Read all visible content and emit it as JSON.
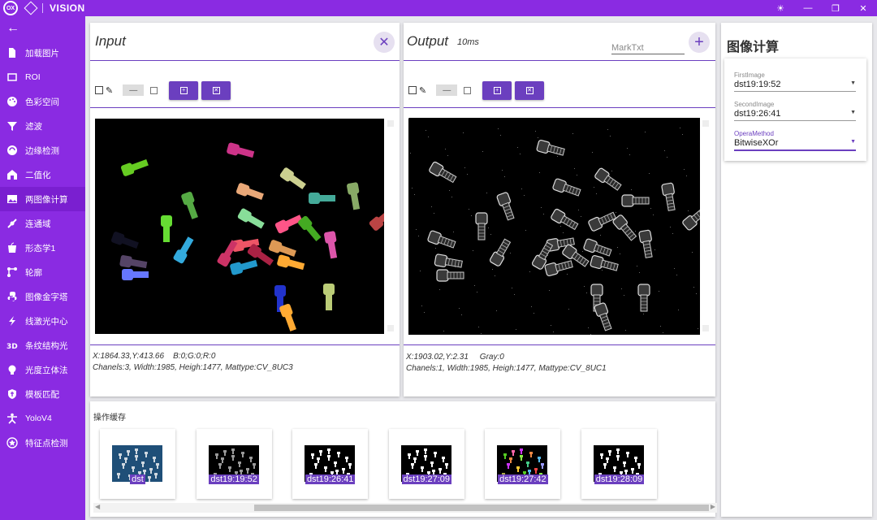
{
  "app": {
    "title": "VISION",
    "logo_text": "OX"
  },
  "sidebar": {
    "items": [
      {
        "label": "加载图片",
        "icon": "file-icon"
      },
      {
        "label": "ROI",
        "icon": "rectangle-icon"
      },
      {
        "label": "色彩空间",
        "icon": "palette-icon"
      },
      {
        "label": "滤波",
        "icon": "filter-icon"
      },
      {
        "label": "边缘检测",
        "icon": "edge-detect-icon"
      },
      {
        "label": "二值化",
        "icon": "home-icon"
      },
      {
        "label": "两图像计算",
        "icon": "image-icon"
      },
      {
        "label": "连通域",
        "icon": "connect-icon"
      },
      {
        "label": "形态学1",
        "icon": "apple-icon"
      },
      {
        "label": "轮廓",
        "icon": "contour-icon"
      },
      {
        "label": "图像金字塔",
        "icon": "python-icon"
      },
      {
        "label": "线激光中心",
        "icon": "flash-icon"
      },
      {
        "label": "条纹结构光",
        "icon": "3d-icon"
      },
      {
        "label": "光度立体法",
        "icon": "bulb-icon"
      },
      {
        "label": "模板匹配",
        "icon": "shield-icon"
      },
      {
        "label": "YoloV4",
        "icon": "person-icon"
      },
      {
        "label": "特征点检测",
        "icon": "star-icon"
      }
    ],
    "active_index": 6
  },
  "input_panel": {
    "title": "Input",
    "info_line1": "X:1864.33,Y:413.66    B:0;G:0;R:0",
    "info_line2": "Chanels:3, Width:1985, Heigh:1477, Mattype:CV_8UC3"
  },
  "output_panel": {
    "title": "Output",
    "time": "10ms",
    "mark_placeholder": "MarkTxt",
    "info_line1": "X:1903.02,Y:2.31     Gray:0",
    "info_line2": "Chanels:1, Width:1985, Heigh:1477, Mattype:CV_8UC1"
  },
  "right_panel": {
    "title": "图像计算",
    "fields": [
      {
        "label": "FirstImage",
        "value": "dst19:19:52"
      },
      {
        "label": "SecondImage",
        "value": "dst19:26:41"
      },
      {
        "label": "OperaMethod",
        "value": "BitwiseXOr"
      }
    ]
  },
  "cache": {
    "title": "操作缓存",
    "items": [
      {
        "label": "dst",
        "kind": "color-photo"
      },
      {
        "label": "dst19:19:52",
        "kind": "gray"
      },
      {
        "label": "dst19:26:41",
        "kind": "binary"
      },
      {
        "label": "dst19:27:09",
        "kind": "binary"
      },
      {
        "label": "dst19:27:42",
        "kind": "labels"
      },
      {
        "label": "dst19:28:09",
        "kind": "binary"
      }
    ],
    "selected_index": 4
  },
  "colors": {
    "accent": "#8a2be2",
    "accent_dark": "#6b3fbf"
  }
}
